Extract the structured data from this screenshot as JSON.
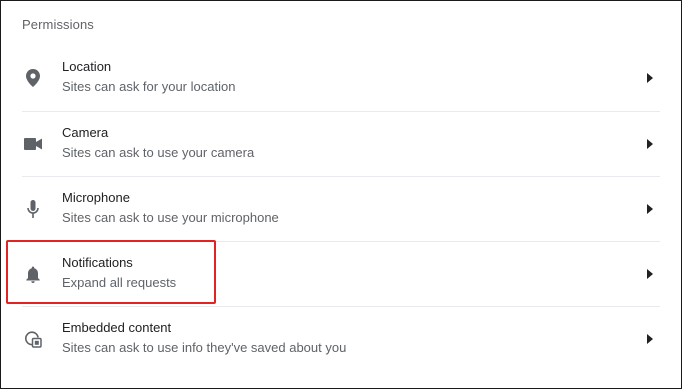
{
  "section": {
    "title": "Permissions"
  },
  "permissions": [
    {
      "label": "Location",
      "sublabel": "Sites can ask for your location",
      "icon": "location-pin-icon"
    },
    {
      "label": "Camera",
      "sublabel": "Sites can ask to use your camera",
      "icon": "camera-icon"
    },
    {
      "label": "Microphone",
      "sublabel": "Sites can ask to use your microphone",
      "icon": "microphone-icon"
    },
    {
      "label": "Notifications",
      "sublabel": "Expand all requests",
      "icon": "bell-icon"
    },
    {
      "label": "Embedded content",
      "sublabel": "Sites can ask to use info they've saved about you",
      "icon": "embedded-content-icon"
    }
  ],
  "colors": {
    "highlight": "#e02424",
    "icon": "#5f6368",
    "divider": "#e8eaed"
  }
}
